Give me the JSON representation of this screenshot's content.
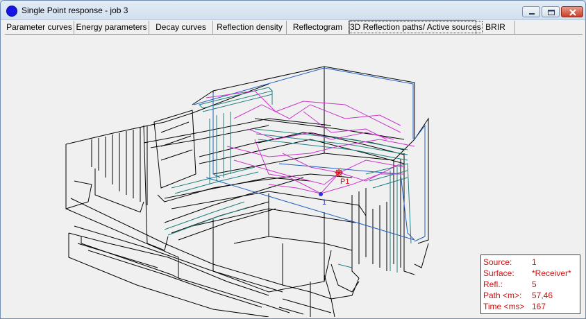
{
  "window": {
    "title": "Single Point response - job 3",
    "controls": {
      "minimize": "minimize",
      "maximize": "maximize",
      "close": "close"
    }
  },
  "tabs": [
    {
      "label": "Parameter curves",
      "active": false
    },
    {
      "label": "Energy parameters",
      "active": false
    },
    {
      "label": "Decay curves",
      "active": false
    },
    {
      "label": "Reflection density",
      "active": false
    },
    {
      "label": "Reflectogram",
      "active": false
    },
    {
      "label": "3D Reflection paths/ Active sources",
      "active": true
    },
    {
      "label": "BRIR",
      "active": false
    }
  ],
  "viewport": {
    "receiver_label": "P1",
    "source_label": "1",
    "colors": {
      "model_lines": "#000000",
      "blue_lines": "#1f5fbf",
      "teal_lines": "#1f7f7f",
      "reflection_paths": "#cc33cc",
      "receiver": "#d01010",
      "source": "#3030e0"
    }
  },
  "info": {
    "source_label": "Source:",
    "source_value": "1",
    "surface_label": "Surface:",
    "surface_value": "*Receiver*",
    "refl_label": "Refl.:",
    "refl_value": "5",
    "path_label": "Path <m>:",
    "path_value": "57,46",
    "time_label": "Time <ms>",
    "time_value": "167"
  }
}
